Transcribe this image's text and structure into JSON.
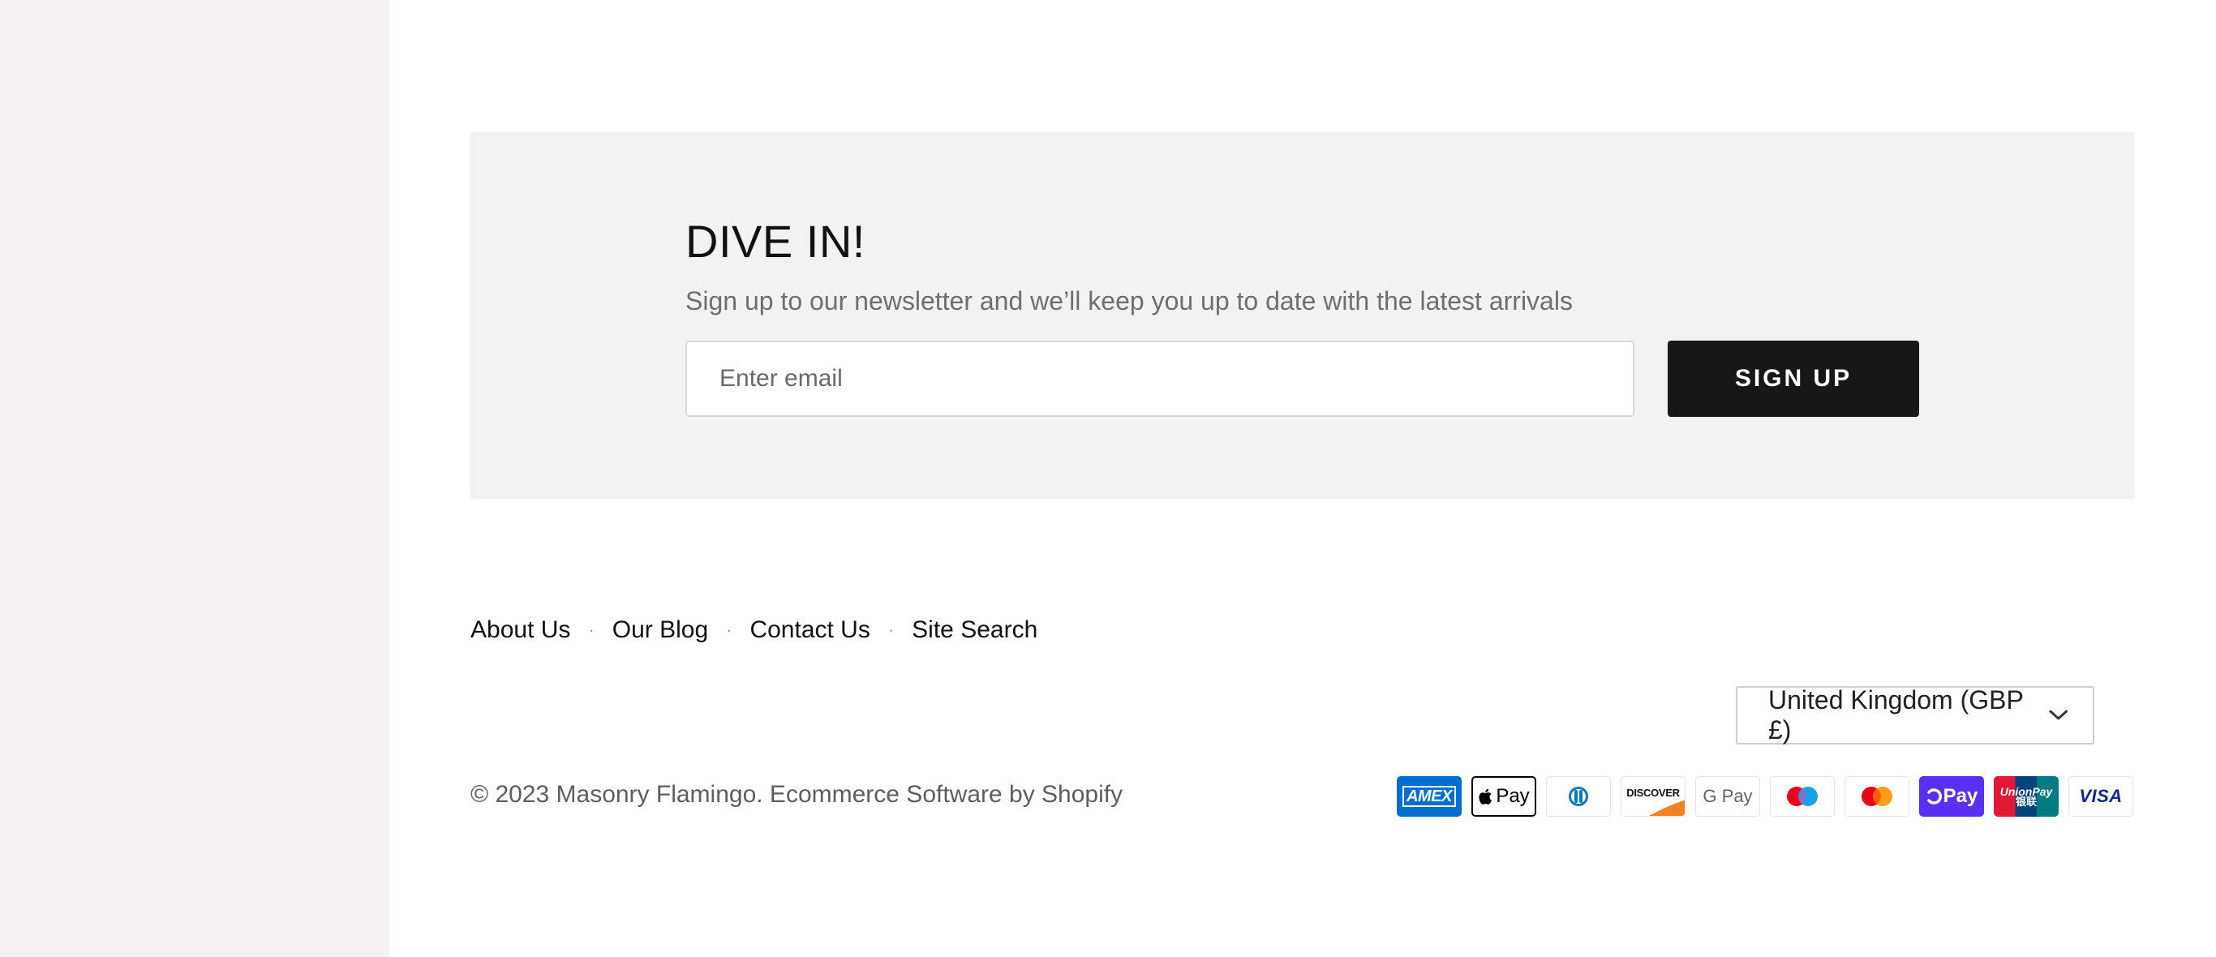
{
  "newsletter": {
    "title": "DIVE IN!",
    "subtitle": "Sign up to our newsletter and we’ll keep you up to date with the latest arrivals",
    "email_placeholder": "Enter email",
    "signup_label": "SIGN UP"
  },
  "footer": {
    "links": [
      {
        "label": "About Us"
      },
      {
        "label": "Our Blog"
      },
      {
        "label": "Contact Us"
      },
      {
        "label": "Site Search"
      }
    ],
    "separator": "·",
    "country_selector": {
      "selected": "United Kingdom (GBP £)",
      "icon": "chevron-down-icon"
    },
    "copyright": "© 2023 Masonry Flamingo. Ecommerce Software by Shopify",
    "payment_methods": [
      {
        "name": "American Express",
        "label": "AMEX",
        "icon": "amex-icon",
        "color": "#016fd0"
      },
      {
        "name": "Apple Pay",
        "label": "Pay",
        "icon": "apple-pay-icon",
        "color": "#000000"
      },
      {
        "name": "Diners Club",
        "icon": "diners-club-icon",
        "color": "#0079be"
      },
      {
        "name": "Discover",
        "label": "DISCOVER",
        "icon": "discover-icon",
        "color": "#f38021"
      },
      {
        "name": "Google Pay",
        "label": "G Pay",
        "icon": "google-pay-icon",
        "color": "#5f6368"
      },
      {
        "name": "Maestro",
        "icon": "maestro-icon",
        "color": "#eb001b"
      },
      {
        "name": "Mastercard",
        "icon": "mastercard-icon",
        "color": "#f79e1b"
      },
      {
        "name": "Shop Pay",
        "label": "Pay",
        "icon": "shop-pay-icon",
        "color": "#5a31f4"
      },
      {
        "name": "UnionPay",
        "label": "UnionPay",
        "sublabel": "银联",
        "icon": "unionpay-icon",
        "color": "#e21836"
      },
      {
        "name": "Visa",
        "label": "VISA",
        "icon": "visa-icon",
        "color": "#142688"
      }
    ]
  },
  "colors": {
    "left_panel_bg": "#f7f0f0",
    "newsletter_bg": "#f2f2f2",
    "button_bg": "#171717"
  }
}
